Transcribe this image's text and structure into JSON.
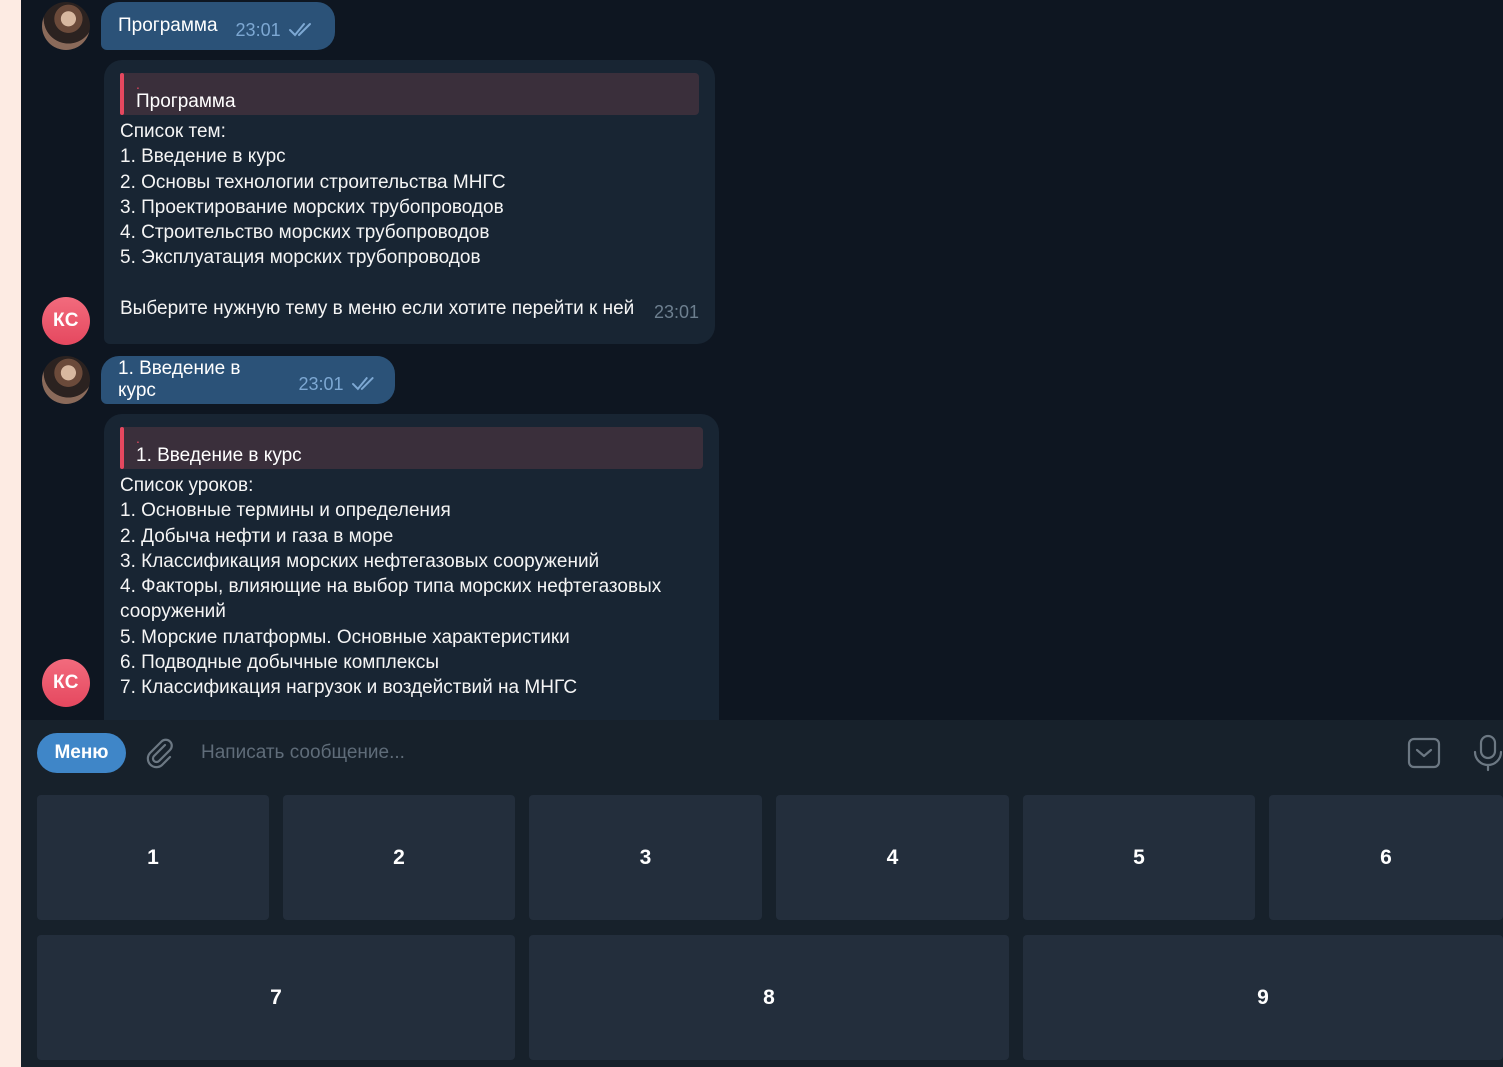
{
  "messages": [
    {
      "type": "outgoing",
      "text": "Программа",
      "time": "23:01"
    },
    {
      "type": "incoming",
      "avatar": "КС",
      "reply_author": ".",
      "reply_text": "Программа",
      "lines": [
        "Список тем:",
        "1. Введение в курс",
        "2. Основы технологии строительства МНГС",
        "3. Проектирование морских трубопроводов",
        "4. Строительство морских трубопроводов",
        "5. Эксплуатация морских трубопроводов",
        "",
        "Выберите нужную тему в меню если хотите перейти к ней"
      ],
      "time": "23:01"
    },
    {
      "type": "outgoing",
      "text": "1. Введение в курс",
      "time": "23:01"
    },
    {
      "type": "incoming",
      "avatar": "КС",
      "reply_author": ".",
      "reply_text": "1. Введение в курс",
      "lines": [
        "Список уроков:",
        "1. Основные термины и определения",
        "2. Добыча нефти и газа в море",
        "3. Классификация морских нефтегазовых сооружений",
        "4. Факторы, влияющие на выбор типа морских нефтегазовых",
        "сооружений",
        "5. Морские платформы. Основные характеристики",
        "6. Подводные добычные комплексы",
        "7. Классификация нагрузок и воздействий на МНГС"
      ]
    }
  ],
  "composer": {
    "menu_label": "Меню",
    "placeholder": "Написать сообщение..."
  },
  "keyboard": {
    "row1": [
      "1",
      "2",
      "3",
      "4",
      "5",
      "6"
    ],
    "row2": [
      "7",
      "8",
      "9"
    ]
  },
  "colors": {
    "background": "#0e1621",
    "outgoing_bubble": "#2b5278",
    "incoming_bubble": "#182533",
    "accent": "#3f86c8",
    "bot_avatar": "#e5485f",
    "key": "#232e3c"
  },
  "icons": [
    "attach-icon",
    "bot-keyboard-icon",
    "microphone-icon",
    "double-check-icon"
  ]
}
